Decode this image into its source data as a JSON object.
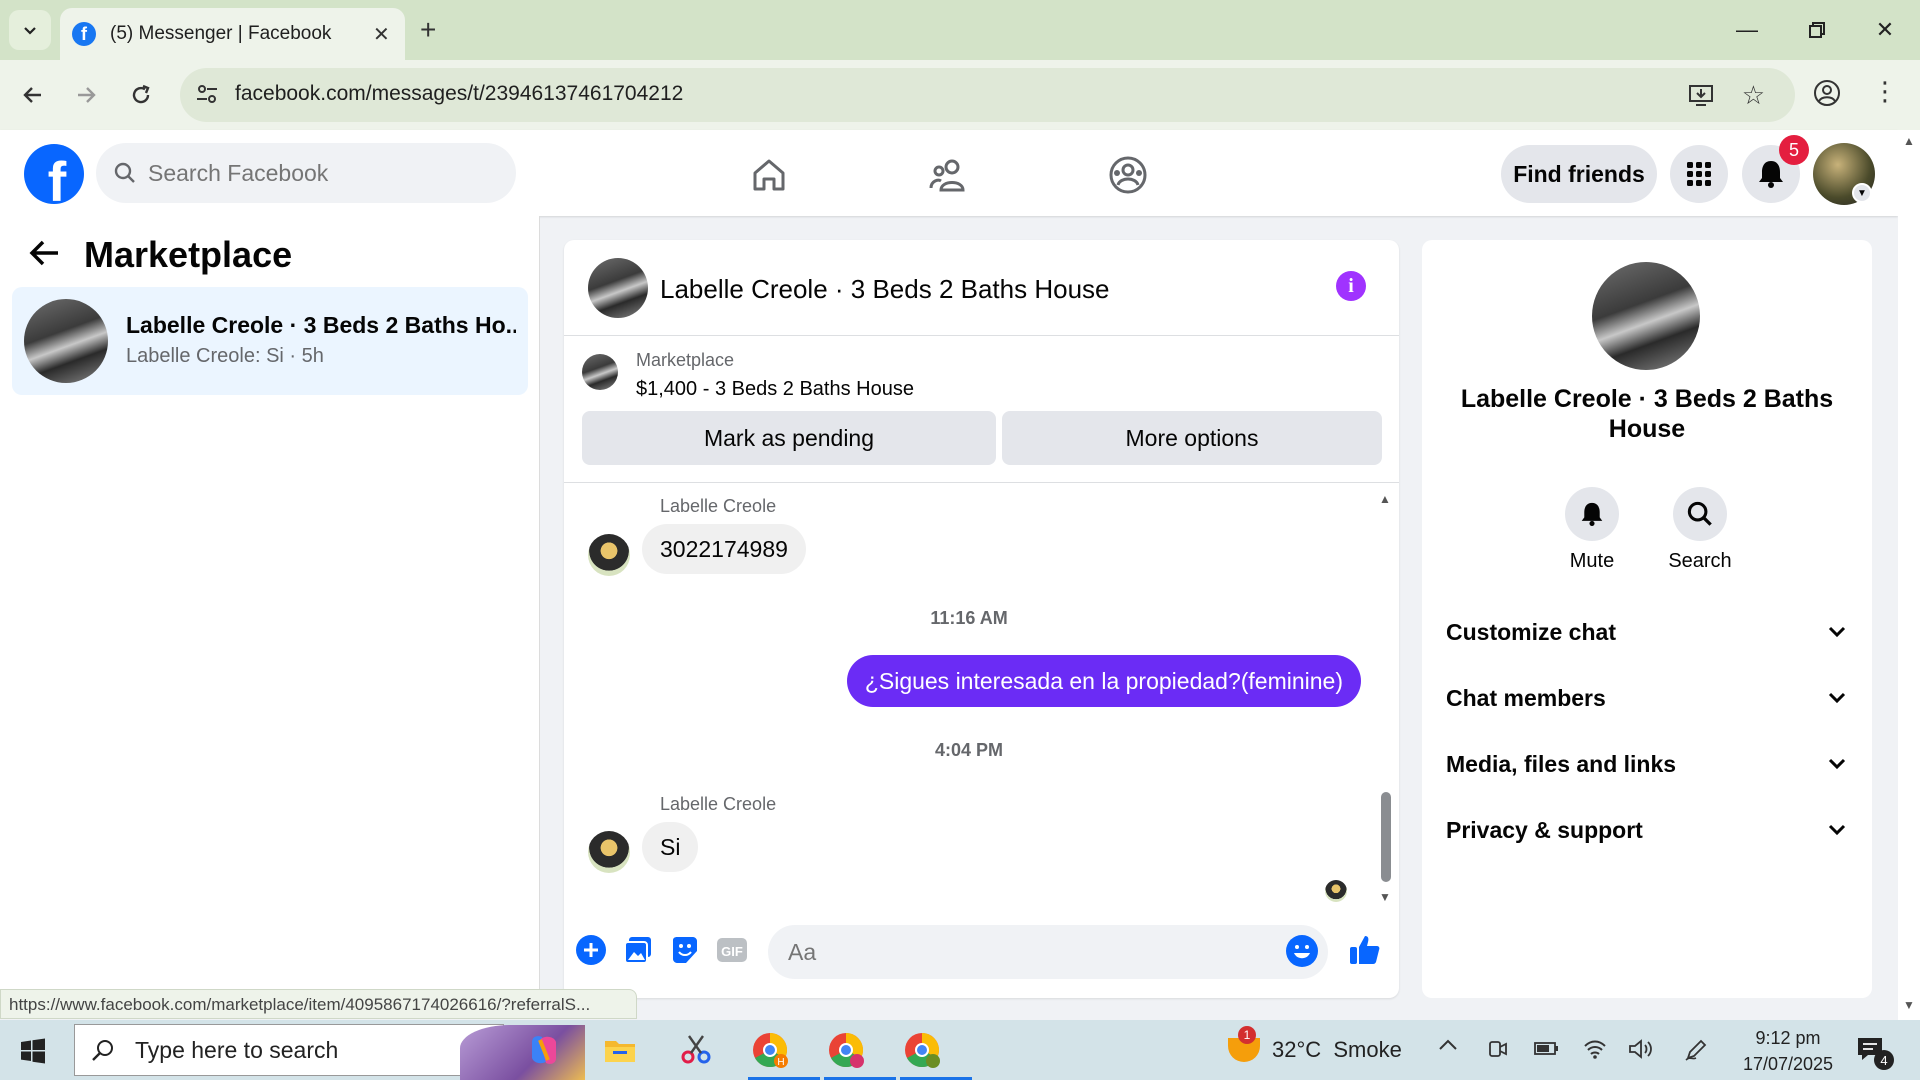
{
  "browser": {
    "tab_title": "(5) Messenger | Facebook",
    "url": "facebook.com/messages/t/23946137461704212",
    "status_url": "https://www.facebook.com/marketplace/item/4095867174026616/?referralS..."
  },
  "header": {
    "search_placeholder": "Search Facebook",
    "find_friends_label": "Find friends",
    "notification_count": "5"
  },
  "sidebar": {
    "title": "Marketplace",
    "conversation": {
      "title": "Labelle Creole · 3 Beds 2 Baths Ho...",
      "snippet": "Labelle Creole: Si · 5h"
    }
  },
  "chat": {
    "title": "Labelle Creole · 3 Beds 2 Baths House",
    "listing": {
      "label": "Marketplace",
      "price_title": "$1,400 - 3 Beds 2 Baths House"
    },
    "actions": {
      "mark_pending": "Mark as pending",
      "more_options": "More options"
    },
    "messages": [
      {
        "sender": "Labelle Creole",
        "text": "3022174989"
      },
      {
        "timestamp": "11:16 AM"
      },
      {
        "text": "¿Sigues interesada en la propiedad?(feminine)"
      },
      {
        "timestamp": "4:04 PM"
      },
      {
        "sender": "Labelle Creole",
        "text": "Si"
      }
    ],
    "composer_placeholder": "Aa"
  },
  "details": {
    "title": "Labelle Creole · 3 Beds 2 Baths House",
    "mute_label": "Mute",
    "search_label": "Search",
    "sections": [
      "Customize chat",
      "Chat members",
      "Media, files and links",
      "Privacy & support"
    ]
  },
  "taskbar": {
    "search_placeholder": "Type here to search",
    "weather": "32°C  Smoke",
    "weather_badge": "1",
    "time": "9:12 pm",
    "date": "17/07/2025",
    "notification_count": "4"
  },
  "colors": {
    "accent": "#0866ff",
    "outgoing_bubble": "#6b2cf5",
    "info_icon": "#a033ff",
    "badge": "#e41e3f"
  }
}
